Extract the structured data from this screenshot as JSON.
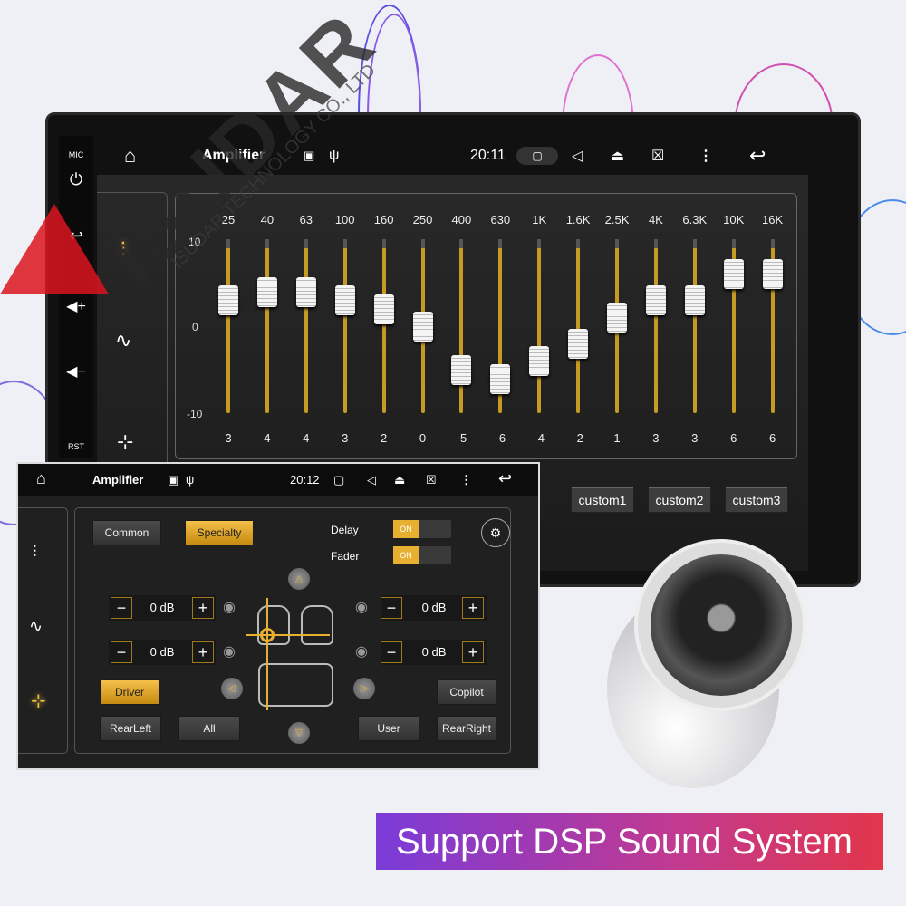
{
  "watermark": {
    "brand": "ISUDAR",
    "company": "ISUDAR TECHNOLOGY CO., LTD"
  },
  "device": {
    "side_panel": {
      "mic": "MIC",
      "rst": "RST"
    },
    "status_bar": {
      "title": "Amplifier",
      "time": "20:11"
    },
    "equalizer": {
      "scale": [
        "10",
        "0",
        "-10"
      ],
      "bands": [
        {
          "freq": "25",
          "value": 3
        },
        {
          "freq": "40",
          "value": 4
        },
        {
          "freq": "63",
          "value": 4
        },
        {
          "freq": "100",
          "value": 3
        },
        {
          "freq": "160",
          "value": 2
        },
        {
          "freq": "250",
          "value": 0
        },
        {
          "freq": "400",
          "value": -5
        },
        {
          "freq": "630",
          "value": -6
        },
        {
          "freq": "1K",
          "value": -4
        },
        {
          "freq": "1.6K",
          "value": -2
        },
        {
          "freq": "2.5K",
          "value": 1
        },
        {
          "freq": "4K",
          "value": 3
        },
        {
          "freq": "6.3K",
          "value": 3
        },
        {
          "freq": "10K",
          "value": 6
        },
        {
          "freq": "16K",
          "value": 6
        }
      ],
      "range": [
        -10,
        10
      ]
    },
    "presets": [
      "custom1",
      "custom2",
      "custom3"
    ]
  },
  "inset": {
    "status_bar": {
      "title": "Amplifier",
      "time": "20:12"
    },
    "tabs": {
      "common": "Common",
      "specialty": "Specialty"
    },
    "delay": {
      "label": "Delay",
      "state": "ON"
    },
    "fader": {
      "label": "Fader",
      "state": "ON"
    },
    "levels": {
      "front_left": "0 dB",
      "front_right": "0 dB",
      "rear_left": "0 dB",
      "rear_right": "0 dB"
    },
    "buttons": {
      "driver": "Driver",
      "copilot": "Copilot",
      "rear_left": "RearLeft",
      "all": "All",
      "user": "User",
      "rear_right": "RearRight"
    },
    "accent": "#e8b030"
  },
  "banner": {
    "text": "Support DSP Sound System"
  }
}
